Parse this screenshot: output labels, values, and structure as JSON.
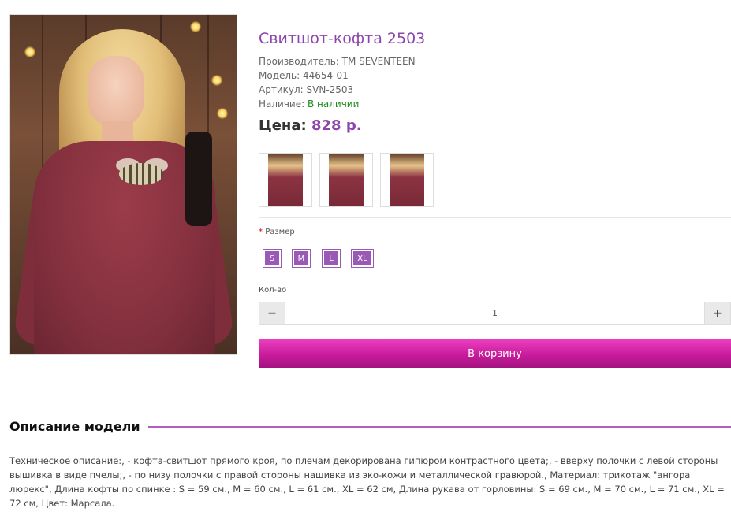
{
  "product": {
    "title": "Свитшот-кофта 2503",
    "manufacturer_label": "Производитель:",
    "manufacturer": "TM SEVENTEEN",
    "model_label": "Модель:",
    "model": "44654-01",
    "sku_label": "Артикул:",
    "sku": "SVN-2503",
    "availability_label": "Наличие:",
    "availability": "В наличии",
    "price_label": "Цена:",
    "price": "828 р."
  },
  "options": {
    "size_required_mark": "*",
    "size_label": "Размер",
    "sizes": [
      "S",
      "M",
      "L",
      "XL"
    ]
  },
  "quantity": {
    "label": "Кол-во",
    "value": "1",
    "minus": "−",
    "plus": "+"
  },
  "cart_button": "В корзину",
  "description": {
    "heading": "Описание модели",
    "text": "Техническое описание:, - кофта-свитшот прямого кроя, по плечам декорирована гипюром контрастного цвета;, - вверху полочки с левой стороны вышивка в виде пчелы;, - по низу полочки с правой стороны нашивка из эко-кожи и металлической гравюрой., Материал: трикотаж \"ангора люрекс\", Длина кофты по спинке : S = 59 см., M = 60 см., L = 61 см., XL = 62 см, Длина рукава от горловины: S = 69 см., M = 70 см., L = 71 см., XL = 72 см, Цвет: Марсала."
  },
  "colors": {
    "accent": "#8e44ad",
    "size_button": "#9b59b6",
    "cart_button": "#c81b9c",
    "in_stock": "#1e8a1e"
  }
}
